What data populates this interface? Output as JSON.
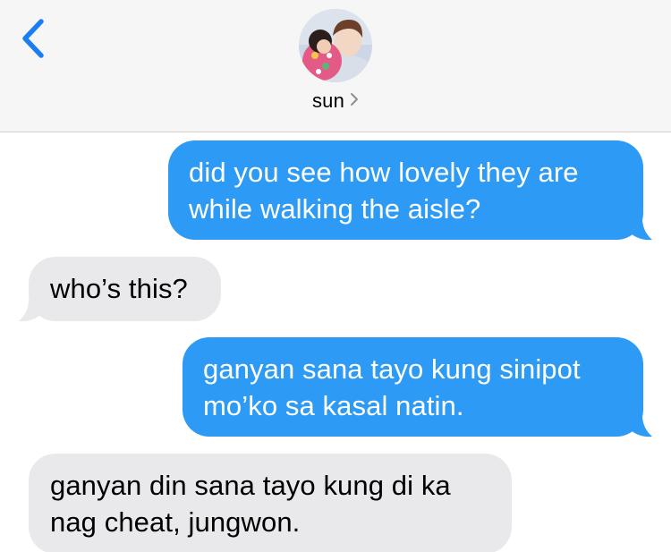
{
  "header": {
    "contact_name": "sun",
    "back_icon": "chevron-left-icon",
    "name_chevron_icon": "chevron-right-icon"
  },
  "colors": {
    "header_bg": "#f6f6f6",
    "sent_bubble": "#2d9bf5",
    "received_bubble": "#e9e9eb",
    "accent": "#1a7ef2"
  },
  "messages": [
    {
      "sender": "me",
      "lines": [
        "did you see how lovely they are",
        "while walking the aisle?"
      ]
    },
    {
      "sender": "them",
      "lines": [
        "who’s this?"
      ]
    },
    {
      "sender": "me",
      "lines": [
        "ganyan sana tayo kung sinipot",
        "mo’ko sa kasal natin."
      ]
    },
    {
      "sender": "them",
      "lines": [
        "ganyan din sana tayo kung di ka",
        "nag cheat, jungwon."
      ]
    }
  ]
}
